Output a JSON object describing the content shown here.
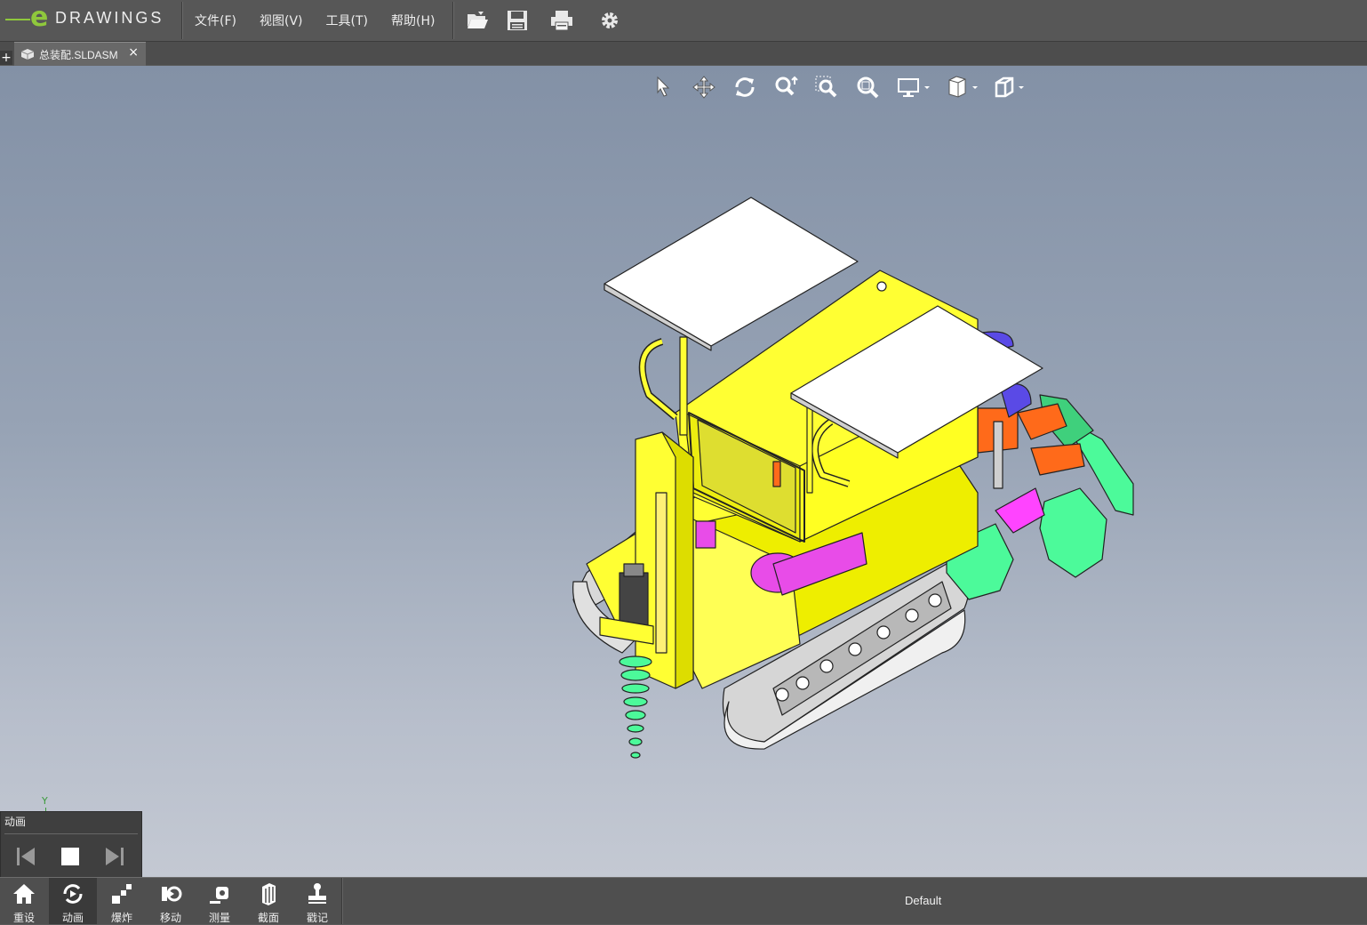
{
  "app": {
    "logo_text": "DRAWINGS"
  },
  "menu": {
    "file": "文件(F)",
    "view": "视图(V)",
    "tools": "工具(T)",
    "help": "帮助(H)"
  },
  "tab": {
    "title": "总装配.SLDASM",
    "close": "×",
    "new": "+"
  },
  "axis": {
    "y_label": "Y"
  },
  "animation_panel": {
    "title": "动画"
  },
  "bottom": {
    "reset": "重设",
    "animate": "动画",
    "explode": "爆炸",
    "move": "移动",
    "measure": "测量",
    "section": "截面",
    "stamp": "戳记",
    "configuration": "Default"
  }
}
